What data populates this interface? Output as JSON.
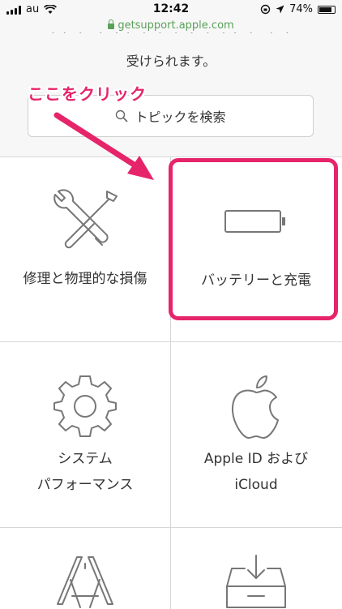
{
  "status_bar": {
    "carrier": "au",
    "time": "12:42",
    "battery": "74%"
  },
  "url_bar": {
    "domain": "getsupport.apple.com"
  },
  "header": {
    "subtitle": "受けられます。"
  },
  "annotation": {
    "text": "ここをクリック",
    "color": "#e6246a"
  },
  "search": {
    "label": "トピックを検索"
  },
  "tiles": [
    {
      "line1": "修理と物理的な損傷",
      "icon": "wrench-screwdriver-icon"
    },
    {
      "line1": "バッテリーと充電",
      "icon": "battery-icon"
    },
    {
      "line1": "システム",
      "line2": "パフォーマンス",
      "icon": "gear-icon"
    },
    {
      "line1": "Apple ID および",
      "line2": "iCloud",
      "icon": "apple-icon"
    }
  ]
}
